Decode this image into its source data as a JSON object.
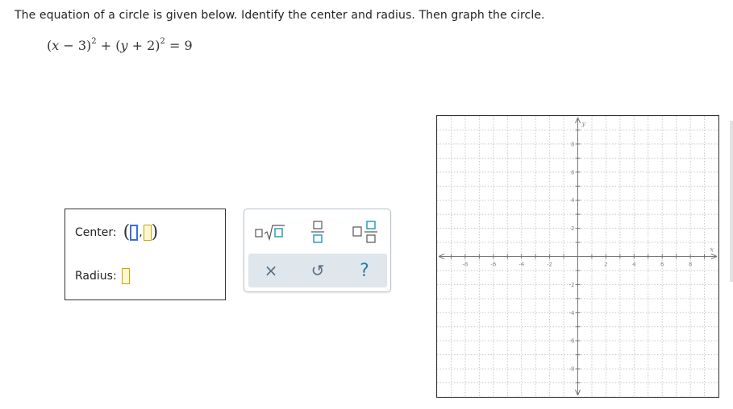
{
  "question": {
    "text": "The equation of a circle is given below. Identify the center and radius. Then graph the circle."
  },
  "equation": {
    "part1_open": "(",
    "var_x": "x",
    "part1_rest": " − 3)",
    "exp1": "2",
    "plus": " + (",
    "var_y": "y",
    "part2_rest": " + 2)",
    "exp2": "2",
    "equals": " = 9"
  },
  "answer": {
    "center_label": "Center:",
    "radius_label": "Radius:",
    "center_open": "(",
    "center_comma": ",",
    "center_close": ")"
  },
  "palette": {
    "tools": [
      "sqrt-template",
      "fraction-template",
      "mixed-number-template"
    ],
    "actions": {
      "clear": "×",
      "undo": "↺",
      "help": "?"
    }
  },
  "graph": {
    "x_axis_label": "x",
    "y_axis_label": "y",
    "x_range": [
      -10,
      10
    ],
    "y_range": [
      -10,
      10
    ],
    "grid_step": 1,
    "x_tick_labels": [
      "-8",
      "-6",
      "-4",
      "-2",
      "2",
      "4",
      "6",
      "8"
    ],
    "y_tick_labels": [
      "8",
      "6",
      "4",
      "2",
      "-2",
      "-4",
      "-6",
      "-8"
    ],
    "colors": {
      "grid": "#c8c8c8",
      "axis": "#777777",
      "label": "#888888"
    }
  }
}
